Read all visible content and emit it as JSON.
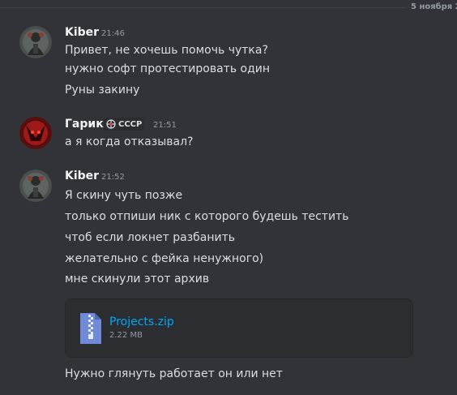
{
  "date_divider": "5 ноября 2",
  "messages": [
    {
      "author": "Kiber",
      "time": "21:46",
      "lines": [
        "Привет, не хочешь помочь чутка?",
        "нужно софт протестировать один",
        "Руны закину"
      ]
    },
    {
      "author": "Гарик",
      "tag": "СССР",
      "time": "21:51",
      "lines": [
        "а я когда отказывал?"
      ]
    },
    {
      "author": "Kiber",
      "time": "21:52",
      "lines": [
        "Я скину чуть позже",
        "только отпиши ник с которого будешь тестить",
        "чтоб если локнет разбанить",
        "желательно с фейка ненужного)",
        "мне скинули этот архив"
      ],
      "attachment": {
        "name": "Projects.zip",
        "size": "2.22 MB",
        "icon": "zip-file-icon"
      },
      "after_attachment": "Нужно глянуть работает он или нет"
    }
  ],
  "colors": {
    "background": "#313338",
    "text": "#dbdee1",
    "author": "#f2f3f5",
    "muted": "#949ba4",
    "link": "#00a8fc",
    "attachment_bg": "#2b2d31"
  }
}
